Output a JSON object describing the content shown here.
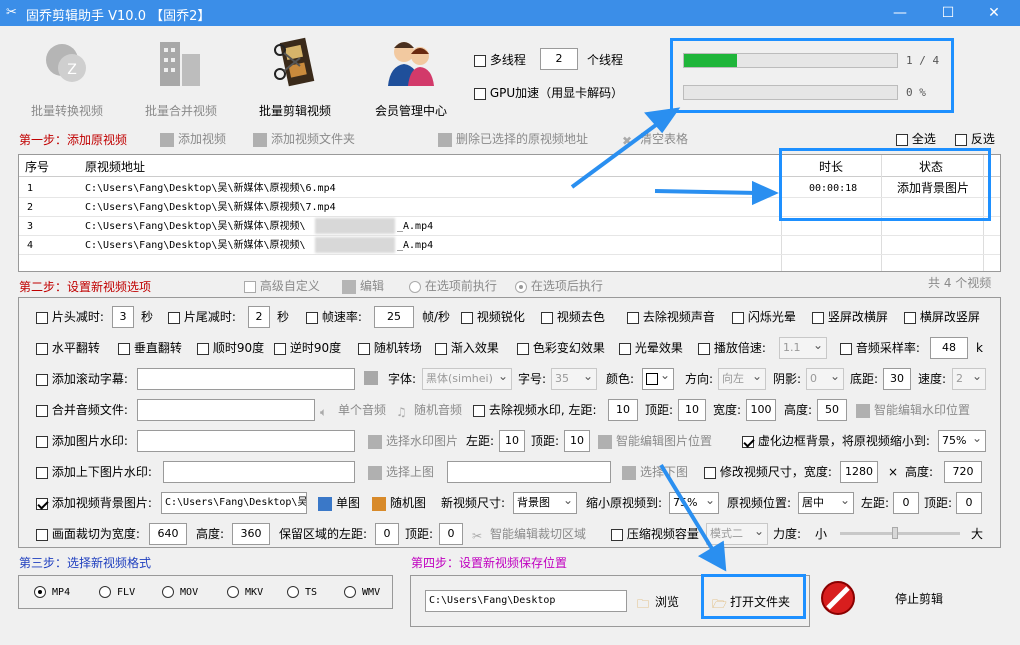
{
  "window": {
    "title": "固乔剪辑助手 V10.0  【固乔2】",
    "minimize": "—",
    "maximize": "☐",
    "close": "✕"
  },
  "toolbar": {
    "batch_convert": "批量转换视频",
    "batch_merge": "批量合并视频",
    "batch_edit": "批量剪辑视频",
    "member_center": "会员管理中心"
  },
  "threads": {
    "multithread_label": "多线程",
    "count": "2",
    "unit": "个线程",
    "gpu_label": "GPU加速（用显卡解码）"
  },
  "progress": {
    "total_text": "1 / 4",
    "total_fraction": 0.25,
    "current_text": "0 %",
    "current_fraction": 0
  },
  "step1": {
    "title": "第一步：添加原视频",
    "add_video": "添加视频",
    "add_folder": "添加视频文件夹",
    "delete_selected": "删除已选择的原视频地址",
    "clear_table": "清空表格",
    "select_all": "全选",
    "invert": "反选"
  },
  "table": {
    "headers": {
      "index": "序号",
      "path": "原视频地址",
      "duration": "时长",
      "status": "状态"
    },
    "rows": [
      {
        "index": "1",
        "path": "C:\\Users\\Fang\\Desktop\\吴\\新媒体\\原视频\\6.mp4",
        "duration": "00:00:18",
        "status": "添加背景图片"
      },
      {
        "index": "2",
        "path": "C:\\Users\\Fang\\Desktop\\吴\\新媒体\\原视频\\7.mp4",
        "duration": "",
        "status": ""
      },
      {
        "index": "3",
        "path": "C:\\Users\\Fang\\Desktop\\吴\\新媒体\\原视频\\",
        "suffix": "_A.mp4",
        "duration": "",
        "status": ""
      },
      {
        "index": "4",
        "path": "C:\\Users\\Fang\\Desktop\\吴\\新媒体\\原视频\\",
        "suffix": "_A.mp4",
        "duration": "",
        "status": ""
      }
    ],
    "count_text": "共 4 个视频"
  },
  "step2": {
    "title": "第二步：设置新视频选项",
    "advanced": "高级自定义",
    "edit": "编辑",
    "before": "在选项前执行",
    "after": "在选项后执行",
    "row1": {
      "head_cut": "片头减时:",
      "head_val": "3",
      "sec": "秒",
      "tail_cut": "片尾减时:",
      "tail_val": "2",
      "fps": "帧速率:",
      "fps_val": "25",
      "fps_unit": "帧/秒",
      "sharpen": "视频锐化",
      "decolor": "视频去色",
      "remove_audio": "去除视频声音",
      "flash": "闪烁光晕",
      "v2h": "竖屏改横屏",
      "h2v": "横屏改竖屏"
    },
    "row2": {
      "hflip": "水平翻转",
      "vflip": "垂直翻转",
      "cw90": "顺时90度",
      "ccw90": "逆时90度",
      "rand_trans": "随机转场",
      "fade_in": "渐入效果",
      "color_anim": "色彩变幻效果",
      "halo": "光晕效果",
      "speed": "播放倍速:",
      "speed_val": "1.1",
      "sample_rate": "音频采样率:",
      "sample_val": "48",
      "k": "k"
    },
    "row3": {
      "scroll_sub": "添加滚动字幕:",
      "font": "字体:",
      "font_val": "黑体(simhei)",
      "size": "字号:",
      "size_val": "35",
      "color": "颜色:",
      "direction": "方向:",
      "direction_val": "向左",
      "shadow": "阴影:",
      "shadow_val": "0",
      "bottom": "底距:",
      "bottom_val": "30",
      "speed": "速度:",
      "speed_val": "2"
    },
    "row4": {
      "merge_audio": "合并音频文件:",
      "single_audio": "单个音频",
      "rand_audio": "随机音频",
      "remove_wm": "去除视频水印, 左距:",
      "left_val": "10",
      "top": "顶距:",
      "top_val": "10",
      "width": "宽度:",
      "width_val": "100",
      "height": "高度:",
      "height_val": "50",
      "smart_wm": "智能编辑水印位置"
    },
    "row5": {
      "img_wm": "添加图片水印:",
      "choose_wm": "选择水印图片",
      "left": "左距:",
      "left_val": "10",
      "top": "顶距:",
      "top_val": "10",
      "smart_img": "智能编辑图片位置",
      "blur_bg": "虚化边框背景，将原视频缩小到:",
      "blur_val": "75%"
    },
    "row6": {
      "updown_wm": "添加上下图片水印:",
      "choose_top": "选择上图",
      "choose_bottom": "选择下图",
      "resize": "修改视频尺寸，宽度:",
      "w_val": "1280",
      "x": "×",
      "h_label": "高度:",
      "h_val": "720"
    },
    "row7": {
      "bg_img": "添加视频背景图片:",
      "bg_path": "C:\\Users\\Fang\\Desktop\\吴",
      "single": "单图",
      "random": "随机图",
      "new_size": "新视频尺寸:",
      "new_size_val": "背景图",
      "shrink": "缩小原视频到:",
      "shrink_val": "75%",
      "pos": "原视频位置:",
      "pos_val": "居中",
      "left": "左距:",
      "left_val": "0",
      "top": "顶距:",
      "top_val": "0"
    },
    "row8": {
      "crop": "画面裁切为宽度:",
      "crop_w": "640",
      "height": "高度:",
      "crop_h": "360",
      "keep_left": "保留区域的左距:",
      "keep_left_val": "0",
      "top": "顶距:",
      "top_val": "0",
      "smart_crop": "智能编辑裁切区域",
      "compress": "压缩视频容量",
      "mode_val": "模式二",
      "strength": "力度:",
      "small": "小",
      "big": "大"
    }
  },
  "step3": {
    "title": "第三步：选择新视频格式",
    "formats": [
      "MP4",
      "FLV",
      "MOV",
      "MKV",
      "TS",
      "WMV"
    ],
    "selected": "MP4"
  },
  "step4": {
    "title": "第四步：设置新视频保存位置",
    "path": "C:\\Users\\Fang\\Desktop",
    "browse": "浏览",
    "open_folder": "打开文件夹",
    "stop": "停止剪辑"
  },
  "colors": {
    "titlebar": "#3b8ee8",
    "progress_green": "#1fb53a",
    "highlight": "#1e90ff",
    "step1": "#c00000",
    "step3": "#1f3fbf",
    "step4": "#c000c0"
  }
}
